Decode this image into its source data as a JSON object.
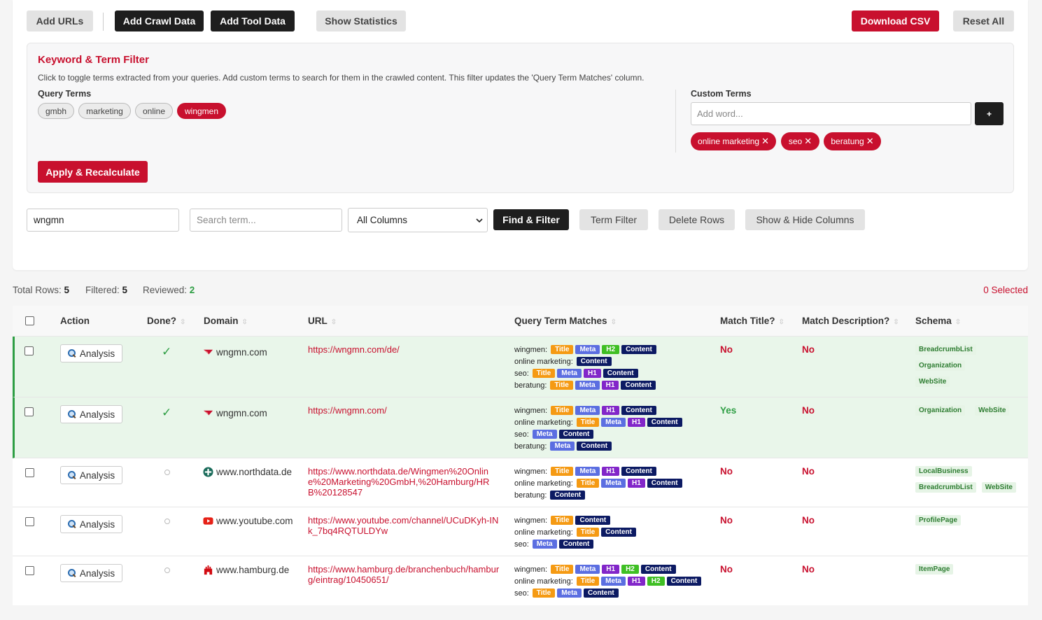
{
  "toolbar": {
    "add_urls": "Add URLs",
    "add_crawl": "Add Crawl Data",
    "add_tool": "Add Tool Data",
    "show_stats": "Show Statistics",
    "download_csv": "Download CSV",
    "reset_all": "Reset All"
  },
  "filter": {
    "title": "Keyword & Term Filter",
    "description": "Click to toggle terms extracted from your queries. Add custom terms to search for them in the crawled content. This filter updates the 'Query Term Matches' column.",
    "query_terms_label": "Query Terms",
    "query_terms": [
      "gmbh",
      "marketing",
      "online",
      "wingmen"
    ],
    "custom_terms_label": "Custom Terms",
    "custom_placeholder": "Add word...",
    "add_button": "+",
    "custom_terms": [
      "online marketing",
      "seo",
      "beratung"
    ],
    "remove_glyph": "✕",
    "apply_button": "Apply & Recalculate"
  },
  "search": {
    "find_value": "wngmn",
    "term_placeholder": "Search term...",
    "column_select": "All Columns",
    "find_filter": "Find & Filter",
    "term_filter": "Term Filter",
    "delete_rows": "Delete Rows",
    "show_hide": "Show & Hide Columns"
  },
  "stats": {
    "total_label": "Total Rows:",
    "total": "5",
    "filtered_label": "Filtered:",
    "filtered": "5",
    "reviewed_label": "Reviewed:",
    "reviewed": "2",
    "selected": "0 Selected"
  },
  "table": {
    "headers": {
      "action": "Action",
      "done": "Done?",
      "domain": "Domain",
      "url": "URL",
      "qtm": "Query Term Matches",
      "match_title": "Match Title?",
      "match_desc": "Match Description?",
      "schema": "Schema"
    },
    "analysis_label": "Analysis",
    "check": "✓",
    "rows": [
      {
        "domain": "wngmn.com",
        "url": "https://wngmn.com/de/",
        "match_title": "No",
        "match_desc": "No",
        "terms": [
          {
            "key": "wingmen:",
            "badges": [
              "Title",
              "Meta",
              "H2",
              "Content"
            ]
          },
          {
            "key": "online marketing:",
            "badges": [
              "Content"
            ]
          },
          {
            "key": "seo:",
            "badges": [
              "Title",
              "Meta",
              "H1",
              "Content"
            ]
          },
          {
            "key": "beratung:",
            "badges": [
              "Title",
              "Meta",
              "H1",
              "Content"
            ]
          }
        ],
        "schema": [
          "BreadcrumbList",
          "Organization",
          "WebSite"
        ]
      },
      {
        "domain": "wngmn.com",
        "url": "https://wngmn.com/",
        "match_title": "Yes",
        "match_desc": "No",
        "terms": [
          {
            "key": "wingmen:",
            "badges": [
              "Title",
              "Meta",
              "H1",
              "Content"
            ]
          },
          {
            "key": "online marketing:",
            "badges": [
              "Title",
              "Meta",
              "H1",
              "Content"
            ]
          },
          {
            "key": "seo:",
            "badges": [
              "Meta",
              "Content"
            ]
          },
          {
            "key": "beratung:",
            "badges": [
              "Meta",
              "Content"
            ]
          }
        ],
        "schema": [
          "Organization",
          "WebSite"
        ]
      },
      {
        "domain": "www.northdata.de",
        "url": "https://www.northdata.de/Wingmen%20Online%20Marketing%20GmbH,%20Hamburg/HRB%20128547",
        "match_title": "No",
        "match_desc": "No",
        "terms": [
          {
            "key": "wingmen:",
            "badges": [
              "Title",
              "Meta",
              "H1",
              "Content"
            ]
          },
          {
            "key": "online marketing:",
            "badges": [
              "Title",
              "Meta",
              "H1",
              "Content"
            ]
          },
          {
            "key": "beratung:",
            "badges": [
              "Content"
            ]
          }
        ],
        "schema": [
          "LocalBusiness",
          "BreadcrumbList",
          "WebSite"
        ]
      },
      {
        "domain": "www.youtube.com",
        "url": "https://www.youtube.com/channel/UCuDKyh-INk_7bq4RQTULDYw",
        "match_title": "No",
        "match_desc": "No",
        "terms": [
          {
            "key": "wingmen:",
            "badges": [
              "Title",
              "Content"
            ]
          },
          {
            "key": "online marketing:",
            "badges": [
              "Title",
              "Content"
            ]
          },
          {
            "key": "seo:",
            "badges": [
              "Meta",
              "Content"
            ]
          }
        ],
        "schema": [
          "ProfilePage"
        ]
      },
      {
        "domain": "www.hamburg.de",
        "url": "https://www.hamburg.de/branchenbuch/hamburg/eintrag/10450651/",
        "match_title": "No",
        "match_desc": "No",
        "terms": [
          {
            "key": "wingmen:",
            "badges": [
              "Title",
              "Meta",
              "H1",
              "H2",
              "Content"
            ]
          },
          {
            "key": "online marketing:",
            "badges": [
              "Title",
              "Meta",
              "H1",
              "H2",
              "Content"
            ]
          },
          {
            "key": "seo:",
            "badges": [
              "Title",
              "Meta",
              "Content"
            ]
          }
        ],
        "schema": [
          "ItemPage"
        ]
      }
    ]
  }
}
